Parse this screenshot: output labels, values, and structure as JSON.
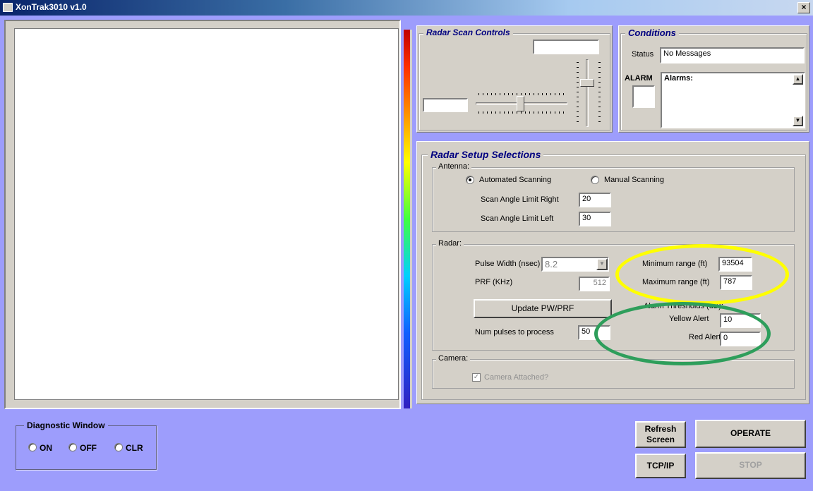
{
  "window": {
    "title": "XonTrak3010 v1.0",
    "close_glyph": "×",
    "app_icon": "app-window-icon"
  },
  "scan_controls": {
    "title": "Radar Scan Controls",
    "top_value": "",
    "left_value": ""
  },
  "conditions": {
    "title": "Conditions",
    "status_label": "Status",
    "status_value": "No Messages",
    "alarm_label": "ALARM",
    "alarms_text": "Alarms:"
  },
  "setup": {
    "title": "Radar Setup Selections",
    "antenna": {
      "legend": "Antenna:",
      "auto_label": "Automated Scanning",
      "manual_label": "Manual Scanning",
      "selected": "Automated Scanning",
      "right_label": "Scan Angle Limit Right",
      "right_value": "20",
      "left_label": "Scan Angle Limit Left",
      "left_value": "30"
    },
    "radar": {
      "legend": "Radar:",
      "pulse_label": "Pulse Width (nsec)",
      "pulse_value": "8.2",
      "prf_label": "PRF (KHz)",
      "prf_value": "512",
      "update_button": "Update PW/PRF",
      "num_pulses_label": "Num pulses to process",
      "num_pulses_value": "50",
      "min_range_label": "Minimum range (ft)",
      "min_range_value": "93504",
      "max_range_label": "Maximum range (ft)",
      "max_range_value": "787",
      "thresholds_label": "Alarm Thresholds (dB):",
      "yellow_label": "Yellow Alert",
      "yellow_value": "10",
      "red_label": "Red Alert",
      "red_value": "0"
    },
    "camera": {
      "legend": "Camera:",
      "attached_label": "Camera Attached?",
      "attached_checked": true
    }
  },
  "diagnostic": {
    "title": "Diagnostic Window",
    "on_label": "ON",
    "off_label": "OFF",
    "clr_label": "CLR"
  },
  "buttons": {
    "refresh_line1": "Refresh",
    "refresh_line2": "Screen",
    "operate": "OPERATE",
    "tcpip": "TCP/IP",
    "stop": "STOP"
  },
  "colors": {
    "background": "#9d9dfc",
    "highlight_yellow": "#ffff00",
    "highlight_green": "#2e9e5b"
  }
}
